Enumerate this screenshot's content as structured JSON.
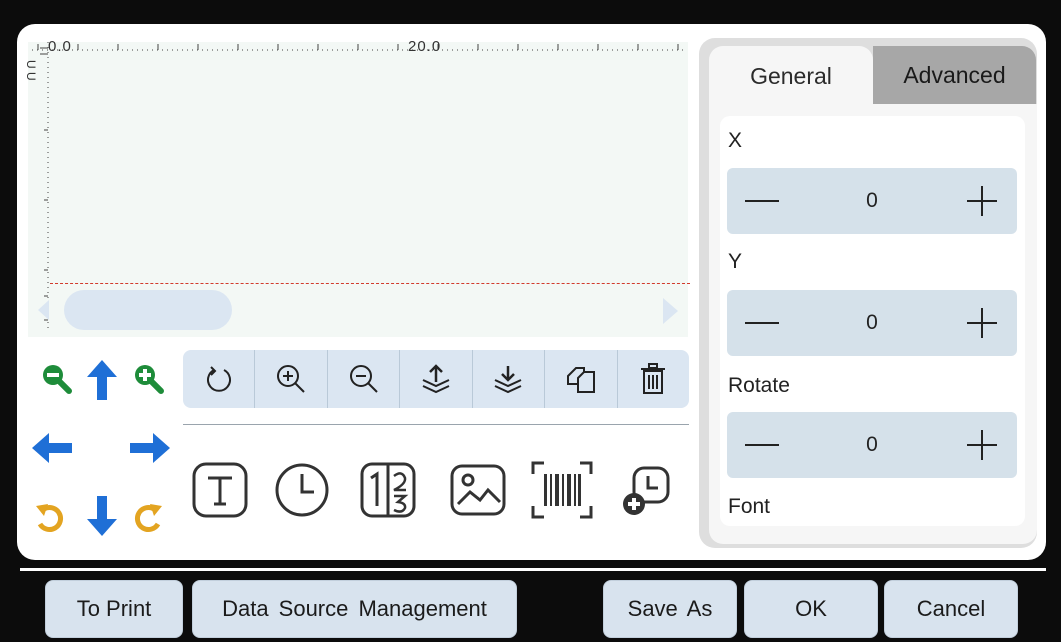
{
  "canvas": {
    "ruler_start_label": "0.0",
    "ruler_mid_label": "20.0",
    "vertical_code": "U U",
    "scrollbar": {
      "left_arrow_icon": "triangle-left-icon",
      "right_arrow_icon": "triangle-right-icon"
    }
  },
  "nudge": {
    "zoom_out_icon": "zoom-out-icon",
    "move_up_icon": "arrow-up-icon",
    "zoom_in_icon": "zoom-in-icon",
    "move_left_icon": "arrow-left-icon",
    "move_right_icon": "arrow-right-icon",
    "rotate_ccw_icon": "rotate-ccw-icon",
    "move_down_icon": "arrow-down-icon",
    "rotate_cw_icon": "rotate-cw-icon"
  },
  "toolbar": {
    "items": [
      "refresh-icon",
      "zoom-in-icon",
      "zoom-out-icon",
      "layer-up-icon",
      "layer-down-icon",
      "copy-icon",
      "delete-icon"
    ]
  },
  "insert": {
    "items": [
      "text-icon",
      "clock-icon",
      "serial-number-icon",
      "image-icon",
      "barcode-icon",
      "time-stamp-icon"
    ]
  },
  "properties": {
    "tabs": {
      "general": "General",
      "advanced": "Advanced"
    },
    "x": {
      "label": "X",
      "value": "0",
      "minus": "—",
      "plus": "+"
    },
    "y": {
      "label": "Y",
      "value": "0",
      "minus": "—",
      "plus": "+"
    },
    "rotate": {
      "label": "Rotate",
      "value": "0",
      "minus": "—",
      "plus": "+"
    },
    "font": {
      "label": "Font"
    }
  },
  "colors": {
    "green": "#1e8c3a",
    "blue": "#1f6fd6",
    "orange": "#e3a421",
    "panel_blue": "#dbe6f2",
    "print_line": "#d13a2c"
  },
  "bottom": {
    "to_print": "To Print",
    "data_source": "Data Source Management",
    "save_as": "Save As",
    "ok": "OK",
    "cancel": "Cancel"
  }
}
